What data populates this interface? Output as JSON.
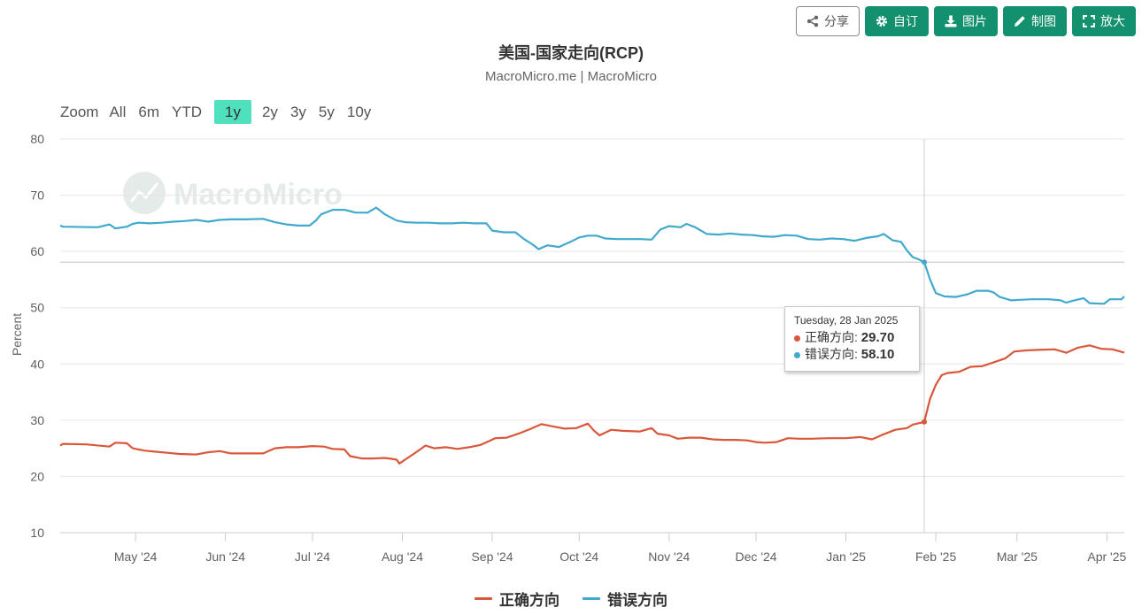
{
  "toolbar": {
    "share_label": "分享",
    "custom_label": "自订",
    "image_label": "图片",
    "make_chart_label": "制图",
    "enlarge_label": "放大",
    "icons": [
      "share-icon",
      "gear-icon",
      "download-icon",
      "pencil-icon",
      "expand-icon"
    ]
  },
  "zoom": {
    "label": "Zoom",
    "options": [
      "All",
      "6m",
      "YTD",
      "1y",
      "2y",
      "3y",
      "5y",
      "10y"
    ],
    "selected": "1y"
  },
  "watermark": "MacroMicro",
  "tooltip": {
    "date": "Tuesday, 28 Jan 2025",
    "rows": [
      {
        "name": "正确方向",
        "value": "29.70"
      },
      {
        "name": "错误方向",
        "value": "58.10"
      }
    ]
  },
  "chart_data": {
    "type": "line",
    "title": "美国-国家走向(RCP)",
    "subtitle": "MacroMicro.me | MacroMicro",
    "ylabel": "Percent",
    "xlabel": "",
    "ylim": [
      10,
      80
    ],
    "yticks": [
      80,
      70,
      60,
      50,
      40,
      30,
      20,
      10
    ],
    "xlim": [
      "2024-04-05",
      "2025-04-07"
    ],
    "xticks": [
      {
        "date": "2024-05-01",
        "label": "May '24"
      },
      {
        "date": "2024-06-01",
        "label": "Jun '24"
      },
      {
        "date": "2024-07-01",
        "label": "Jul '24"
      },
      {
        "date": "2024-08-01",
        "label": "Aug '24"
      },
      {
        "date": "2024-09-01",
        "label": "Sep '24"
      },
      {
        "date": "2024-10-01",
        "label": "Oct '24"
      },
      {
        "date": "2024-11-01",
        "label": "Nov '24"
      },
      {
        "date": "2024-12-01",
        "label": "Dec '24"
      },
      {
        "date": "2025-01-01",
        "label": "Jan '25"
      },
      {
        "date": "2025-02-01",
        "label": "Feb '25"
      },
      {
        "date": "2025-03-01",
        "label": "Mar '25"
      },
      {
        "date": "2025-04-01",
        "label": "Apr '25"
      }
    ],
    "grid": true,
    "crosshair_date": "2025-01-28",
    "legend_position": "bottom-center",
    "series": [
      {
        "name": "正确方向",
        "color": "#d9573a",
        "points": [
          [
            "2024-04-05",
            25.5
          ],
          [
            "2024-04-06",
            25.8
          ],
          [
            "2024-04-14",
            25.7
          ],
          [
            "2024-04-22",
            25.3
          ],
          [
            "2024-04-24",
            26.0
          ],
          [
            "2024-04-28",
            25.9
          ],
          [
            "2024-04-30",
            25.0
          ],
          [
            "2024-05-04",
            24.6
          ],
          [
            "2024-05-08",
            24.4
          ],
          [
            "2024-05-12",
            24.2
          ],
          [
            "2024-05-16",
            24.0
          ],
          [
            "2024-05-22",
            23.9
          ],
          [
            "2024-05-26",
            24.3
          ],
          [
            "2024-05-30",
            24.5
          ],
          [
            "2024-06-03",
            24.1
          ],
          [
            "2024-06-14",
            24.1
          ],
          [
            "2024-06-18",
            25.0
          ],
          [
            "2024-06-22",
            25.2
          ],
          [
            "2024-06-26",
            25.2
          ],
          [
            "2024-07-01",
            25.4
          ],
          [
            "2024-07-05",
            25.3
          ],
          [
            "2024-07-08",
            24.9
          ],
          [
            "2024-07-12",
            24.8
          ],
          [
            "2024-07-14",
            23.6
          ],
          [
            "2024-07-18",
            23.2
          ],
          [
            "2024-07-22",
            23.2
          ],
          [
            "2024-07-26",
            23.3
          ],
          [
            "2024-07-30",
            23.0
          ],
          [
            "2024-07-31",
            22.3
          ],
          [
            "2024-08-02",
            23.0
          ],
          [
            "2024-08-06",
            24.4
          ],
          [
            "2024-08-09",
            25.5
          ],
          [
            "2024-08-12",
            25.0
          ],
          [
            "2024-08-16",
            25.2
          ],
          [
            "2024-08-20",
            24.9
          ],
          [
            "2024-08-24",
            25.2
          ],
          [
            "2024-08-28",
            25.6
          ],
          [
            "2024-08-31",
            26.3
          ],
          [
            "2024-09-02",
            26.8
          ],
          [
            "2024-09-06",
            26.9
          ],
          [
            "2024-09-10",
            27.6
          ],
          [
            "2024-09-14",
            28.4
          ],
          [
            "2024-09-18",
            29.3
          ],
          [
            "2024-09-22",
            28.9
          ],
          [
            "2024-09-26",
            28.5
          ],
          [
            "2024-09-30",
            28.6
          ],
          [
            "2024-10-04",
            29.4
          ],
          [
            "2024-10-06",
            28.2
          ],
          [
            "2024-10-08",
            27.3
          ],
          [
            "2024-10-12",
            28.3
          ],
          [
            "2024-10-16",
            28.1
          ],
          [
            "2024-10-22",
            28.0
          ],
          [
            "2024-10-26",
            28.6
          ],
          [
            "2024-10-28",
            27.6
          ],
          [
            "2024-11-01",
            27.3
          ],
          [
            "2024-11-04",
            26.7
          ],
          [
            "2024-11-08",
            26.9
          ],
          [
            "2024-11-12",
            26.9
          ],
          [
            "2024-11-16",
            26.6
          ],
          [
            "2024-11-20",
            26.5
          ],
          [
            "2024-11-24",
            26.5
          ],
          [
            "2024-11-28",
            26.4
          ],
          [
            "2024-12-01",
            26.1
          ],
          [
            "2024-12-04",
            26.0
          ],
          [
            "2024-12-08",
            26.1
          ],
          [
            "2024-12-12",
            26.8
          ],
          [
            "2024-12-16",
            26.7
          ],
          [
            "2024-12-20",
            26.7
          ],
          [
            "2024-12-26",
            26.8
          ],
          [
            "2025-01-01",
            26.8
          ],
          [
            "2025-01-06",
            27.0
          ],
          [
            "2025-01-10",
            26.6
          ],
          [
            "2025-01-14",
            27.5
          ],
          [
            "2025-01-18",
            28.3
          ],
          [
            "2025-01-22",
            28.6
          ],
          [
            "2025-01-24",
            29.2
          ],
          [
            "2025-01-28",
            29.7
          ],
          [
            "2025-01-30",
            33.8
          ],
          [
            "2025-02-01",
            36.3
          ],
          [
            "2025-02-03",
            38.0
          ],
          [
            "2025-02-05",
            38.4
          ],
          [
            "2025-02-09",
            38.6
          ],
          [
            "2025-02-13",
            39.5
          ],
          [
            "2025-02-17",
            39.6
          ],
          [
            "2025-02-21",
            40.3
          ],
          [
            "2025-02-25",
            41.0
          ],
          [
            "2025-02-28",
            42.2
          ],
          [
            "2025-03-04",
            42.4
          ],
          [
            "2025-03-08",
            42.5
          ],
          [
            "2025-03-14",
            42.6
          ],
          [
            "2025-03-18",
            42.0
          ],
          [
            "2025-03-22",
            42.9
          ],
          [
            "2025-03-26",
            43.3
          ],
          [
            "2025-03-30",
            42.7
          ],
          [
            "2025-04-03",
            42.6
          ],
          [
            "2025-04-07",
            42.0
          ]
        ]
      },
      {
        "name": "错误方向",
        "color": "#41a9cc",
        "points": [
          [
            "2024-04-05",
            64.6
          ],
          [
            "2024-04-06",
            64.4
          ],
          [
            "2024-04-18",
            64.3
          ],
          [
            "2024-04-22",
            64.8
          ],
          [
            "2024-04-24",
            64.1
          ],
          [
            "2024-04-28",
            64.4
          ],
          [
            "2024-04-30",
            64.9
          ],
          [
            "2024-05-02",
            65.1
          ],
          [
            "2024-05-06",
            65.0
          ],
          [
            "2024-05-10",
            65.1
          ],
          [
            "2024-05-14",
            65.3
          ],
          [
            "2024-05-18",
            65.4
          ],
          [
            "2024-05-22",
            65.6
          ],
          [
            "2024-05-26",
            65.3
          ],
          [
            "2024-05-30",
            65.6
          ],
          [
            "2024-06-03",
            65.7
          ],
          [
            "2024-06-08",
            65.7
          ],
          [
            "2024-06-14",
            65.8
          ],
          [
            "2024-06-18",
            65.2
          ],
          [
            "2024-06-22",
            64.8
          ],
          [
            "2024-06-26",
            64.6
          ],
          [
            "2024-06-30",
            64.6
          ],
          [
            "2024-07-02",
            65.4
          ],
          [
            "2024-07-04",
            66.6
          ],
          [
            "2024-07-08",
            67.4
          ],
          [
            "2024-07-12",
            67.4
          ],
          [
            "2024-07-16",
            66.9
          ],
          [
            "2024-07-20",
            66.9
          ],
          [
            "2024-07-23",
            67.8
          ],
          [
            "2024-07-26",
            66.6
          ],
          [
            "2024-07-30",
            65.5
          ],
          [
            "2024-08-02",
            65.2
          ],
          [
            "2024-08-06",
            65.1
          ],
          [
            "2024-08-10",
            65.1
          ],
          [
            "2024-08-14",
            65.0
          ],
          [
            "2024-08-18",
            65.0
          ],
          [
            "2024-08-22",
            65.1
          ],
          [
            "2024-08-26",
            65.0
          ],
          [
            "2024-08-30",
            65.0
          ],
          [
            "2024-09-01",
            63.7
          ],
          [
            "2024-09-05",
            63.4
          ],
          [
            "2024-09-09",
            63.4
          ],
          [
            "2024-09-12",
            62.2
          ],
          [
            "2024-09-15",
            61.2
          ],
          [
            "2024-09-17",
            60.4
          ],
          [
            "2024-09-20",
            61.1
          ],
          [
            "2024-09-24",
            60.8
          ],
          [
            "2024-09-28",
            61.7
          ],
          [
            "2024-10-01",
            62.5
          ],
          [
            "2024-10-04",
            62.8
          ],
          [
            "2024-10-07",
            62.8
          ],
          [
            "2024-10-10",
            62.3
          ],
          [
            "2024-10-14",
            62.2
          ],
          [
            "2024-10-18",
            62.2
          ],
          [
            "2024-10-22",
            62.2
          ],
          [
            "2024-10-26",
            62.1
          ],
          [
            "2024-10-29",
            63.9
          ],
          [
            "2024-11-01",
            64.5
          ],
          [
            "2024-11-05",
            64.3
          ],
          [
            "2024-11-07",
            64.9
          ],
          [
            "2024-11-10",
            64.3
          ],
          [
            "2024-11-14",
            63.1
          ],
          [
            "2024-11-18",
            63.0
          ],
          [
            "2024-11-22",
            63.2
          ],
          [
            "2024-11-26",
            63.0
          ],
          [
            "2024-11-30",
            62.9
          ],
          [
            "2024-12-03",
            62.7
          ],
          [
            "2024-12-07",
            62.6
          ],
          [
            "2024-12-11",
            62.9
          ],
          [
            "2024-12-15",
            62.8
          ],
          [
            "2024-12-19",
            62.2
          ],
          [
            "2024-12-23",
            62.1
          ],
          [
            "2024-12-27",
            62.3
          ],
          [
            "2024-12-31",
            62.2
          ],
          [
            "2025-01-04",
            61.9
          ],
          [
            "2025-01-08",
            62.4
          ],
          [
            "2025-01-12",
            62.7
          ],
          [
            "2025-01-14",
            63.1
          ],
          [
            "2025-01-17",
            62.0
          ],
          [
            "2025-01-20",
            61.7
          ],
          [
            "2025-01-22",
            60.2
          ],
          [
            "2025-01-24",
            59.0
          ],
          [
            "2025-01-26",
            58.6
          ],
          [
            "2025-01-28",
            58.1
          ],
          [
            "2025-01-30",
            55.0
          ],
          [
            "2025-02-01",
            52.6
          ],
          [
            "2025-02-04",
            52.0
          ],
          [
            "2025-02-08",
            51.9
          ],
          [
            "2025-02-12",
            52.4
          ],
          [
            "2025-02-15",
            53.0
          ],
          [
            "2025-02-19",
            53.0
          ],
          [
            "2025-02-21",
            52.7
          ],
          [
            "2025-02-23",
            51.9
          ],
          [
            "2025-02-27",
            51.3
          ],
          [
            "2025-03-02",
            51.4
          ],
          [
            "2025-03-06",
            51.5
          ],
          [
            "2025-03-12",
            51.5
          ],
          [
            "2025-03-16",
            51.3
          ],
          [
            "2025-03-18",
            50.9
          ],
          [
            "2025-03-20",
            51.2
          ],
          [
            "2025-03-24",
            51.7
          ],
          [
            "2025-03-26",
            50.8
          ],
          [
            "2025-03-31",
            50.7
          ],
          [
            "2025-04-02",
            51.5
          ],
          [
            "2025-04-06",
            51.5
          ],
          [
            "2025-04-07",
            52.0
          ]
        ]
      }
    ]
  }
}
